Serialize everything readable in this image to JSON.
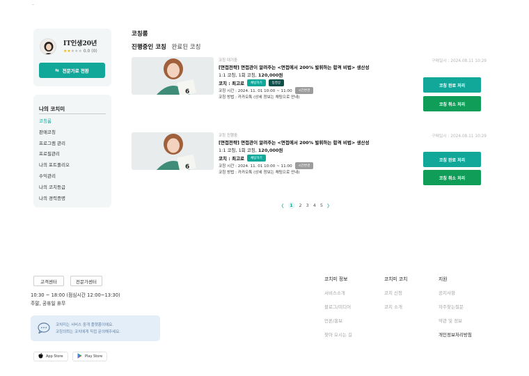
{
  "sidebar": {
    "profile": {
      "name": "IT인생20년",
      "stars_filled": "★★",
      "stars_empty": "★★★",
      "rating_text": "0.0 (0)",
      "switch_button": "전문가로 전환",
      "switch_icon": "swap-arrows-icon"
    },
    "menu": {
      "title": "나의 코치미",
      "items": [
        {
          "label": "코칭룸",
          "active": true
        },
        {
          "label": "판매코칭"
        },
        {
          "label": "프로그램 관리"
        },
        {
          "label": "프로필관리"
        },
        {
          "label": "나의 포트폴리오"
        },
        {
          "label": "수익관리"
        },
        {
          "label": "나의 코치등급"
        },
        {
          "label": "나의 경력증명"
        }
      ]
    }
  },
  "main": {
    "title": "코칭룸",
    "tabs": {
      "active": "진행중인 코칭",
      "inactive": "완료된 코칭"
    },
    "courses": [
      {
        "status": "코칭 대기중",
        "title": "[면접전략] 면접관이 알려주는 <면접에서 200% 발휘하는 합격 비법> 생산성",
        "sub_prefix": "1:1 코칭, 1회 코칭, ",
        "price": "120,000원",
        "coach_label": "코치 : ",
        "coach_name": "최고로",
        "badge_chat": "채팅하기",
        "badge_video": "동영상",
        "time_text": "코칭 시간 : 2024. 11. 01 10:00 ~ 11:00",
        "time_badge": "시간변경",
        "method_text": "코칭 방법 : 카카오톡 (상세 정보는 채팅으로 안내)",
        "purchase_date": "구매일시 : 2024.08.11 10:29",
        "complete_button": "코칭 완료 처리",
        "cancel_button": "코칭 취소 처리"
      },
      {
        "status": "코칭 진행중",
        "title": "[면접전략] 면접관이 알려주는 <면접에서 200% 발휘하는 합격 비법> 생산성",
        "sub_prefix": "1:1 코칭, 1회 코칭, ",
        "price": "120,000원",
        "coach_label": "코치 : ",
        "coach_name": "최고로",
        "badge_chat": "채팅하기",
        "time_text": "코칭 시간 : 2024. 11. 01 10:00 ~ 11:00",
        "time_badge": "시간변경",
        "method_text": "코칭 방법 : 카카오톡 (상세 정보는 채팅으로 안내)",
        "purchase_date": "구매일시 : 2024.08.11 10:29",
        "complete_button": "코칭 완료 처리",
        "cancel_button": "코칭 취소 처리"
      }
    ],
    "pagination": {
      "prev": "〈",
      "pages": [
        "1",
        "2",
        "3",
        "4",
        "5"
      ],
      "current": "1",
      "next": "〉"
    },
    "book_number": "6"
  },
  "footer": {
    "customer_center": "고객센터",
    "expert_center": "전문가센터",
    "hours": "10:30 ~ 18:00 (점심시간 12:00~13:30)",
    "holiday": "주말, 공휴일 휴무",
    "notice_line1": "코치미는 서비스 중개 플랫폼이에요.",
    "notice_line2": "코칭의뢰는 코치에게 직접 문의해주세요.",
    "app_store": "App Store",
    "play_store": "Play Store",
    "columns": [
      {
        "head": "코치미 정보",
        "items": [
          "서비스소개",
          "블로그/미디어",
          "언론/홍보",
          "찾아 오시는 길"
        ]
      },
      {
        "head": "코치미 코치",
        "items": [
          "코치 신청",
          "코치 소개"
        ]
      },
      {
        "head": "지원",
        "items": [
          "공지사항",
          "자주찾는질문",
          "약관 및 정보",
          "개인정보처리방침"
        ]
      }
    ]
  },
  "colors": {
    "accent": "#11a89a",
    "green": "#0f9d58",
    "dark_badge": "#0e4f4a"
  }
}
